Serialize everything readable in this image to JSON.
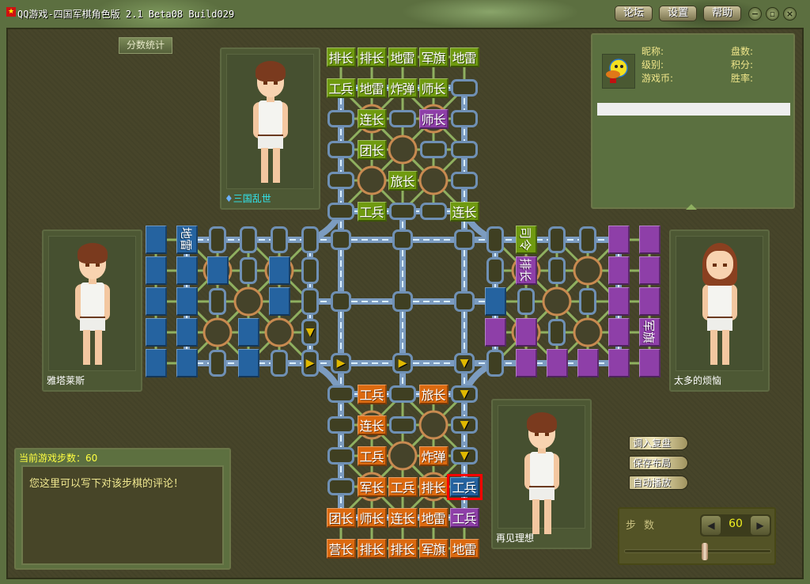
{
  "window": {
    "title": "QQ游戏-四国军棋角色版 2.1 Beta08 Build029",
    "buttons": [
      "论坛",
      "设置",
      "帮助"
    ],
    "controls": [
      "−",
      "▫",
      "×"
    ]
  },
  "score_button": "分数统计",
  "players": {
    "top": {
      "name": "三国乱世",
      "badge": "6"
    },
    "left": {
      "name": "雅塔莱斯"
    },
    "right": {
      "name": "太多的烦恼"
    },
    "bottom": {
      "name": "再见理想"
    }
  },
  "info": {
    "nickname": "昵称:",
    "level": "级别:",
    "coins": "游戏币:",
    "games": "盘数:",
    "points": "积分:",
    "winrate": "胜率:"
  },
  "comment": {
    "step_label": "当前游戏步数：60",
    "text": "您这里可以写下对该步棋的评论！"
  },
  "actions": [
    "调入复盘",
    "保存布局",
    "自动播放"
  ],
  "step": {
    "label": "步数",
    "value": "60",
    "progress": 0.55
  },
  "colors": {
    "green": "#6f9a10",
    "purple": "#8e3fa8",
    "blue": "#2563a0",
    "orange": "#dc6a10"
  },
  "board": {
    "top": [
      [
        {
          "t": "排长",
          "c": "green"
        },
        {
          "t": "排长",
          "c": "green"
        },
        {
          "t": "地雷",
          "c": "green"
        },
        {
          "t": "军旗",
          "c": "green"
        },
        {
          "t": "地雷",
          "c": "green"
        }
      ],
      [
        {
          "t": "工兵",
          "c": "green"
        },
        {
          "t": "地雷",
          "c": "green"
        },
        {
          "t": "炸弹",
          "c": "green"
        },
        {
          "t": "师长",
          "c": "green"
        },
        null
      ],
      [
        null,
        {
          "t": "连长",
          "c": "green"
        },
        null,
        {
          "t": "师长",
          "c": "purple"
        },
        null
      ],
      [
        null,
        {
          "t": "团长",
          "c": "green"
        },
        null,
        null,
        null
      ],
      [
        null,
        null,
        {
          "t": "旅长",
          "c": "green"
        },
        null,
        null
      ],
      [
        null,
        {
          "t": "工兵",
          "c": "green"
        },
        null,
        null,
        {
          "t": "连长",
          "c": "green"
        }
      ]
    ],
    "bottom": [
      [
        null,
        {
          "t": "工兵",
          "c": "orange"
        },
        null,
        {
          "t": "旅长",
          "c": "orange"
        },
        {
          "a": "v"
        }
      ],
      [
        null,
        {
          "t": "连长",
          "c": "orange"
        },
        null,
        null,
        {
          "a": "v"
        }
      ],
      [
        null,
        {
          "t": "工兵",
          "c": "orange"
        },
        null,
        {
          "t": "炸弹",
          "c": "orange"
        },
        {
          "a": "v"
        }
      ],
      [
        null,
        {
          "t": "军长",
          "c": "orange"
        },
        {
          "t": "工兵",
          "c": "orange"
        },
        {
          "t": "排长",
          "c": "orange"
        },
        {
          "t": "工兵",
          "c": "blue",
          "sel": true
        }
      ],
      [
        {
          "t": "团长",
          "c": "orange"
        },
        {
          "t": "师长",
          "c": "orange"
        },
        {
          "t": "连长",
          "c": "orange"
        },
        {
          "t": "地雷",
          "c": "orange"
        },
        {
          "t": "工兵",
          "c": "purple"
        }
      ],
      [
        {
          "t": "营长",
          "c": "orange"
        },
        {
          "t": "排长",
          "c": "orange"
        },
        {
          "t": "排长",
          "c": "orange"
        },
        {
          "t": "军旗",
          "c": "orange"
        },
        {
          "t": "地雷",
          "c": "orange"
        }
      ]
    ],
    "left": [
      [
        {
          "c": "blue"
        },
        {
          "t": "地雷",
          "c": "blue"
        },
        null,
        null,
        null,
        null
      ],
      [
        {
          "c": "blue"
        },
        {
          "c": "blue"
        },
        {
          "c": "blue"
        },
        null,
        {
          "c": "blue"
        },
        null
      ],
      [
        {
          "c": "blue"
        },
        {
          "c": "blue"
        },
        null,
        null,
        {
          "c": "blue"
        },
        null
      ],
      [
        {
          "c": "blue"
        },
        {
          "c": "blue"
        },
        null,
        {
          "c": "blue"
        },
        null,
        {
          "a": "v"
        }
      ],
      [
        {
          "c": "blue"
        },
        {
          "c": "blue"
        },
        null,
        {
          "c": "blue"
        },
        null,
        {
          "a": ">"
        }
      ]
    ],
    "right": [
      [
        null,
        {
          "t": "司令",
          "c": "green"
        },
        null,
        null,
        {
          "c": "purple"
        },
        {
          "c": "purple"
        }
      ],
      [
        null,
        {
          "t": "排长",
          "c": "purple"
        },
        null,
        null,
        {
          "c": "purple"
        },
        {
          "c": "purple"
        }
      ],
      [
        {
          "c": "blue"
        },
        null,
        null,
        null,
        {
          "c": "purple"
        },
        {
          "c": "purple"
        }
      ],
      [
        {
          "c": "purple"
        },
        {
          "c": "purple"
        },
        null,
        null,
        {
          "c": "purple"
        },
        {
          "t": "军旗",
          "c": "purple"
        }
      ],
      [
        null,
        {
          "c": "purple"
        },
        {
          "c": "purple"
        },
        {
          "c": "purple"
        },
        {
          "c": "purple"
        },
        {
          "c": "purple"
        }
      ]
    ],
    "center": [
      [
        null,
        null,
        null
      ],
      [
        null,
        null,
        null
      ],
      [
        {
          "a": ">"
        },
        {
          "a": ">"
        },
        {
          "a": "v"
        }
      ]
    ]
  }
}
